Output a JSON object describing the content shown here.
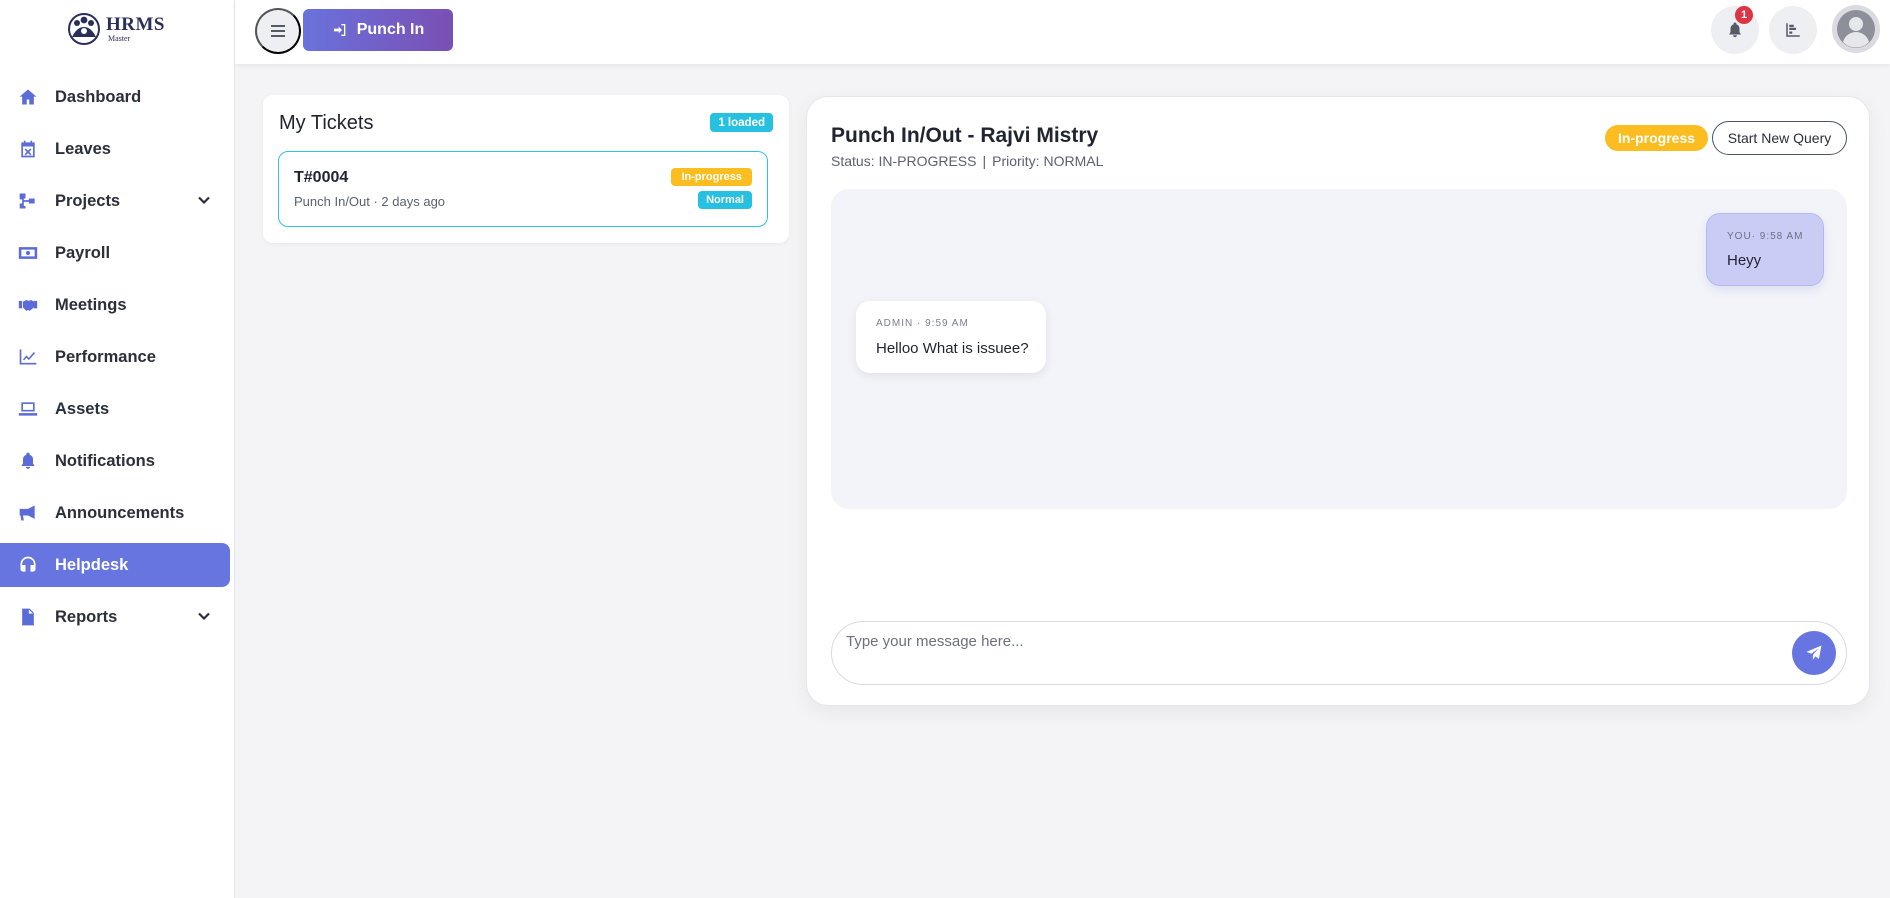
{
  "app": {
    "logo_text": "HRMS",
    "logo_sub": "Master"
  },
  "sidebar": {
    "items": [
      {
        "label": "Dashboard",
        "icon": "home-icon"
      },
      {
        "label": "Leaves",
        "icon": "calendar-x-icon"
      },
      {
        "label": "Projects",
        "icon": "sitemap-icon",
        "expandable": true
      },
      {
        "label": "Payroll",
        "icon": "money-bill-icon"
      },
      {
        "label": "Meetings",
        "icon": "handshake-icon"
      },
      {
        "label": "Performance",
        "icon": "line-chart-icon"
      },
      {
        "label": "Assets",
        "icon": "laptop-icon"
      },
      {
        "label": "Notifications",
        "icon": "bell-icon"
      },
      {
        "label": "Announcements",
        "icon": "megaphone-icon"
      },
      {
        "label": "Helpdesk",
        "icon": "headset-icon",
        "active": true
      },
      {
        "label": "Reports",
        "icon": "file-icon",
        "expandable": true
      }
    ]
  },
  "topbar": {
    "punch_label": "Punch In",
    "notification_count": "1"
  },
  "tickets": {
    "title": "My Tickets",
    "loaded_badge": "1 loaded",
    "items": [
      {
        "id": "T#0004",
        "subtitle": "Punch In/Out · 2 days ago",
        "status": "In-progress",
        "priority": "Normal"
      }
    ]
  },
  "chat": {
    "title": "Punch In/Out - Rajvi Mistry",
    "status_text": "Status: IN-PROGRESS",
    "separator": "|",
    "priority_text": "Priority: NORMAL",
    "status_badge": "In-progress",
    "new_query_label": "Start New Query",
    "messages": [
      {
        "from": "you",
        "meta": "YOU· 9:58 AM",
        "text": "Heyy"
      },
      {
        "from": "admin",
        "meta": "ADMIN · 9:59 AM",
        "text": "Helloo What is issuee?"
      }
    ],
    "input_placeholder": "Type your message here..."
  },
  "colors": {
    "accent": "#6675e0",
    "status_in_progress": "#fbbd1f",
    "info": "#26c0e0",
    "badge_red": "#dc3545"
  }
}
